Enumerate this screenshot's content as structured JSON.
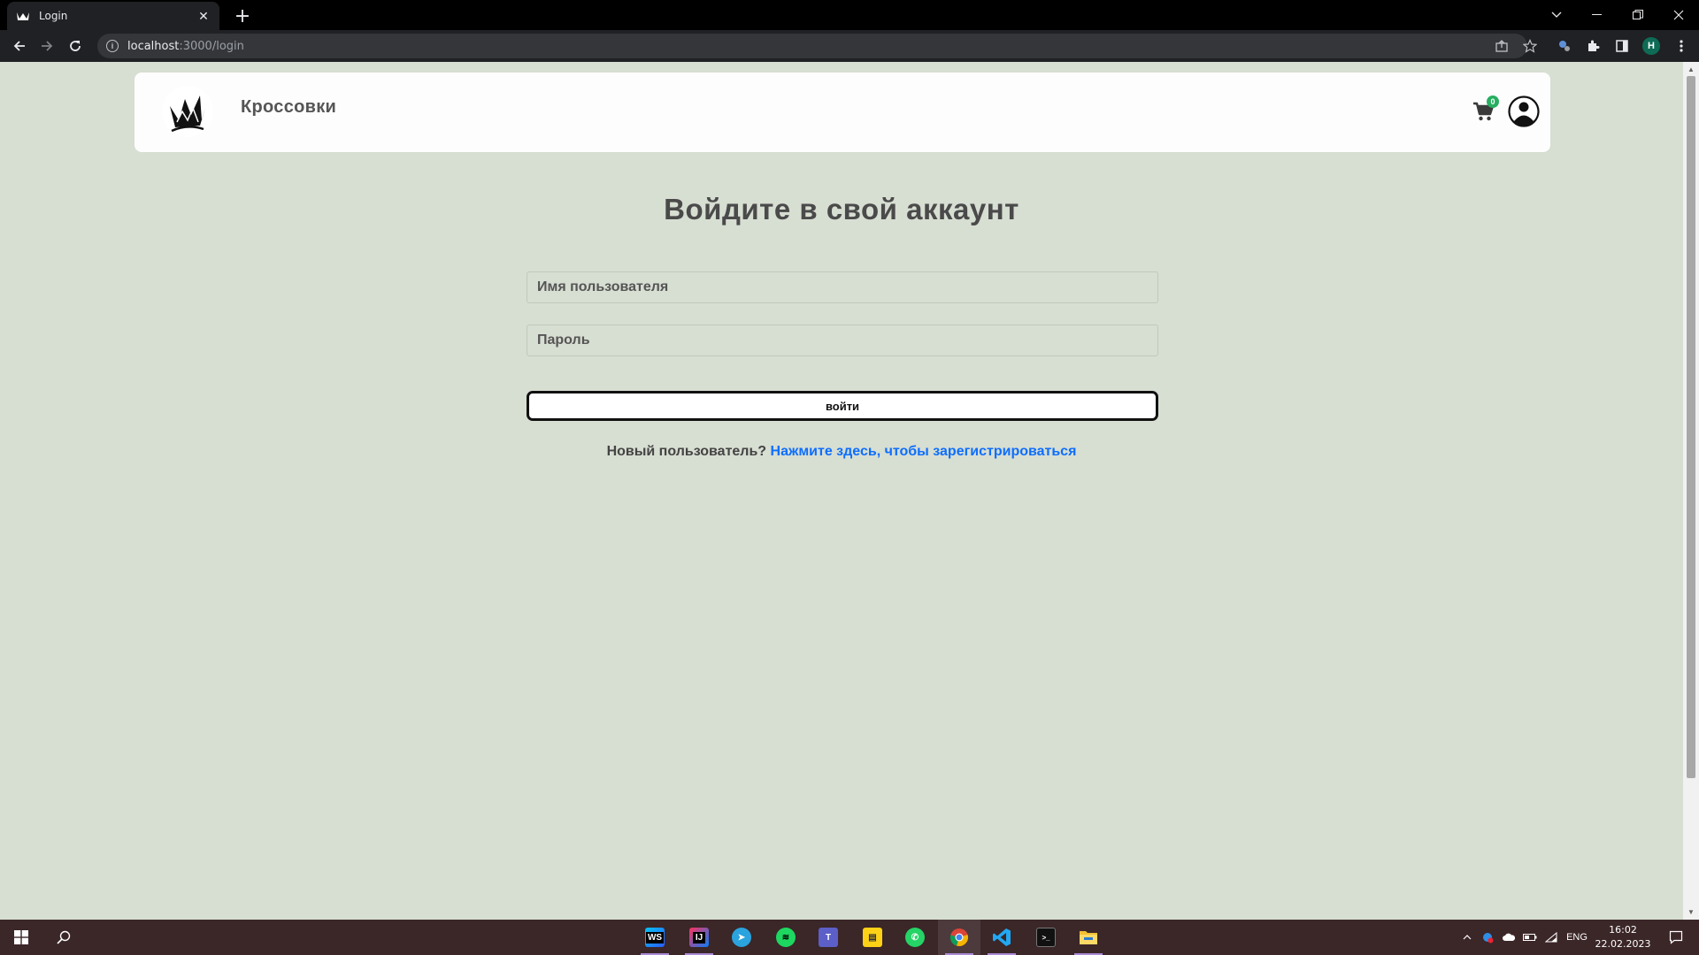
{
  "browser": {
    "tab_title": "Login",
    "tab_close": "✕",
    "new_tab": "+",
    "url_host": "localhost",
    "url_path": ":3000/login",
    "profile_initial": "H"
  },
  "site": {
    "brand": "Кроссовки",
    "cart_count": "0"
  },
  "login": {
    "title": "Войдите в свой аккаунт",
    "username_placeholder": "Имя пользователя",
    "password_placeholder": "Пароль",
    "submit_label": "войти",
    "register_prompt": "Новый пользователь?",
    "register_link": "Нажмите здесь, чтобы зарегистрироваться"
  },
  "taskbar": {
    "apps": [
      "webstorm-icon",
      "intellij-icon",
      "telegram-icon",
      "spotify-icon",
      "teams-icon",
      "sticky-notes-icon",
      "whatsapp-icon",
      "chrome-icon",
      "vscode-icon",
      "terminal-icon",
      "file-explorer-icon"
    ],
    "language": "ENG",
    "time": "16:02",
    "date": "22.02.2023"
  },
  "colors": {
    "page_bg": "#d7ded2",
    "link": "#0d6efd",
    "cart_badge": "#27ae60",
    "taskbar": "#3b2628"
  }
}
